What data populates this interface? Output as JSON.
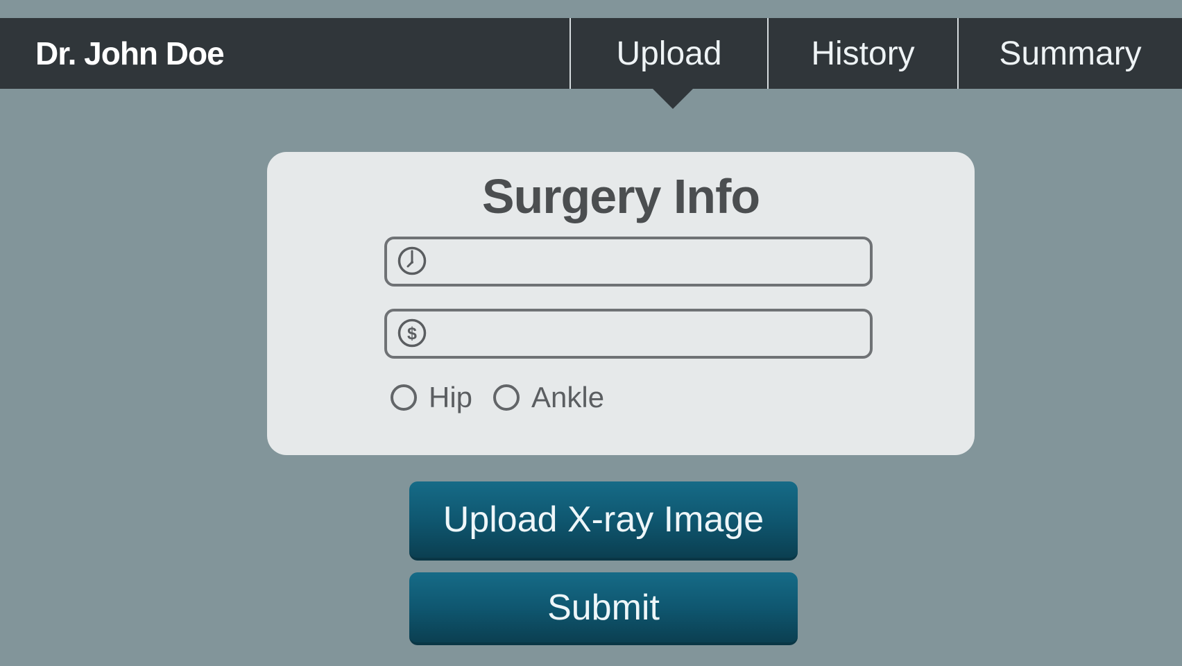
{
  "header": {
    "doctor_name": "Dr. John Doe",
    "tabs": [
      {
        "label": "Upload",
        "active": true
      },
      {
        "label": "History",
        "active": false
      },
      {
        "label": "Summary",
        "active": false
      }
    ]
  },
  "form": {
    "title": "Surgery Info",
    "time_field": {
      "icon": "clock-icon",
      "value": "",
      "placeholder": ""
    },
    "cost_field": {
      "icon": "dollar-icon",
      "value": "",
      "placeholder": ""
    },
    "surgery_type": {
      "options": [
        {
          "label": "Hip",
          "selected": false
        },
        {
          "label": "Ankle",
          "selected": false
        }
      ]
    }
  },
  "actions": {
    "upload_label": "Upload X-ray Image",
    "submit_label": "Submit"
  },
  "colors": {
    "background": "#82959a",
    "header": "#30363a",
    "card": "#e6e9ea",
    "button": "#0f5770"
  }
}
